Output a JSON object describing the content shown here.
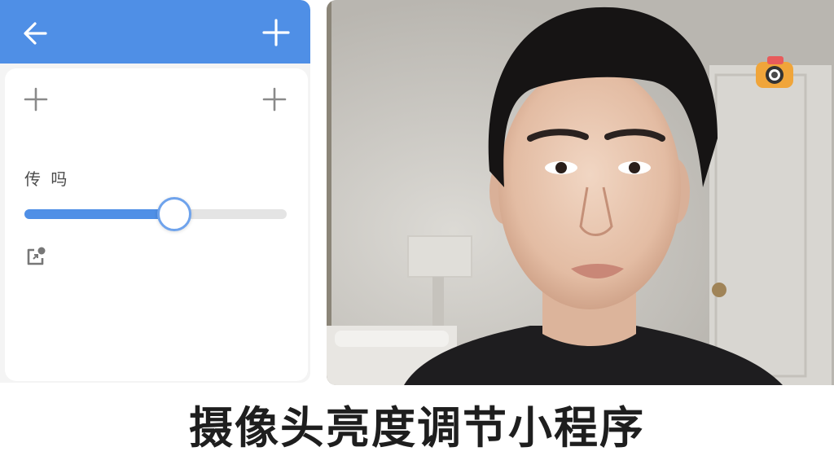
{
  "toolbar": {
    "back_icon": "arrow-left-icon",
    "add_icon": "plus-icon",
    "bar_color": "#4f8fe6"
  },
  "settings": {
    "left_add_icon": "plus-icon",
    "right_add_icon": "plus-icon",
    "slider_label": "传 吗",
    "slider_value_fraction": 0.57,
    "slider_fill_color": "#4f8fe6",
    "switch_camera_icon": "camera-switch-icon"
  },
  "preview": {
    "badge_icon": "camera-icon"
  },
  "caption": {
    "text": "摄像头亮度调节小程序"
  }
}
